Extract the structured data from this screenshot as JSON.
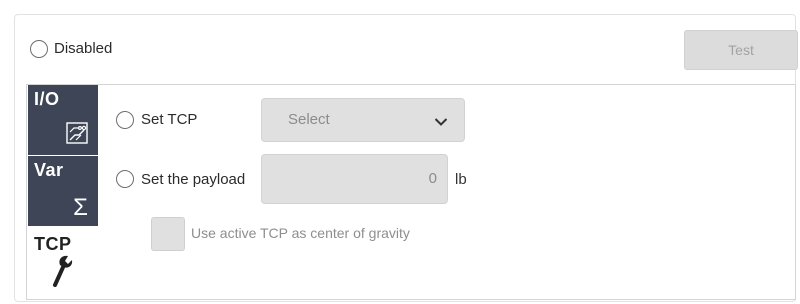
{
  "header": {
    "disabled_label": "Disabled",
    "test_label": "Test"
  },
  "tabs": [
    {
      "label": "I/O",
      "icon": "circuit-board-icon",
      "active": false
    },
    {
      "label": "Var",
      "icon": "sigma-icon",
      "active": false
    },
    {
      "label": "TCP",
      "icon": "wrench-icon",
      "active": true
    }
  ],
  "tcp_panel": {
    "set_tcp_label": "Set TCP",
    "tcp_select_value": "Select",
    "set_payload_label": "Set the payload",
    "payload_value": "0",
    "payload_unit": "lb",
    "use_active_tcp_label": "Use active TCP as center of gravity"
  },
  "colors": {
    "tab_background": "#3d4556",
    "disabled_control": "#e0e0e0"
  }
}
